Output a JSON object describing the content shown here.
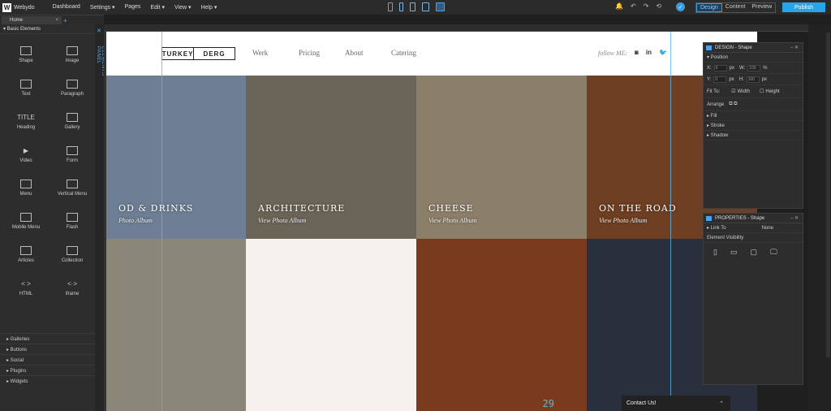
{
  "app": {
    "logo_letter": "W",
    "brand": "Webydo"
  },
  "menu": [
    "Dashboard",
    "Settings ▾",
    "Pages",
    "Edit ▾",
    "View ▾",
    "Help ▾"
  ],
  "modes": {
    "design": "Design",
    "content": "Content",
    "preview": "Preview"
  },
  "publish_label": "Publish",
  "page_tab": {
    "label": "Home",
    "close": "×",
    "add": "+"
  },
  "sidebar": {
    "header": "▾ Basic Elements",
    "elements": [
      {
        "label": "Shape",
        "icon": "shape-icon"
      },
      {
        "label": "Image",
        "icon": "image-icon"
      },
      {
        "label": "Text",
        "icon": "text-icon"
      },
      {
        "label": "Paragraph",
        "icon": "paragraph-icon"
      },
      {
        "label": "Heading",
        "icon": "heading-icon",
        "glyph": "TITLE"
      },
      {
        "label": "Gallery",
        "icon": "gallery-icon"
      },
      {
        "label": "Video",
        "icon": "video-icon",
        "glyph": "▶"
      },
      {
        "label": "Form",
        "icon": "form-icon"
      },
      {
        "label": "Menu",
        "icon": "menu-icon"
      },
      {
        "label": "Vertical Menu",
        "icon": "vertical-menu-icon"
      },
      {
        "label": "Mobile Menu",
        "icon": "mobile-menu-icon"
      },
      {
        "label": "Flash",
        "icon": "flash-icon"
      },
      {
        "label": "Articles",
        "icon": "articles-icon"
      },
      {
        "label": "Collection",
        "icon": "collection-icon"
      },
      {
        "label": "HTML",
        "icon": "html-icon",
        "glyph": "< >"
      },
      {
        "label": "iframe",
        "icon": "iframe-icon",
        "glyph": "<·>"
      }
    ],
    "collapsed": [
      "▸ Galleries",
      "▸ Buttons",
      "▸ Social",
      "▸ Plugins",
      "▸ Widgets"
    ],
    "panel_label": "ELEMENTS PANEL"
  },
  "site": {
    "logo_left": "TURKEY",
    "logo_right": "DERG",
    "nav": [
      "Werk",
      "Pricing",
      "About",
      "Catering"
    ],
    "follow": "follow ME:",
    "social": [
      "◙",
      "in",
      "🐦"
    ]
  },
  "tiles": [
    {
      "title": "OD & DRINKS",
      "sub": "Photo Album",
      "color": "#6e7f95"
    },
    {
      "title": "ARCHITECTURE",
      "sub": "View Photo Album",
      "color": "#6b6558"
    },
    {
      "title": "CHEESE",
      "sub": "View Photo Album",
      "color": "#8c7f6a"
    },
    {
      "title": "ON THE ROAD",
      "sub": "View Photo Album",
      "color": "#6e3f22"
    },
    {
      "title": "",
      "sub": "",
      "color": "#8a8778"
    },
    {
      "title": "",
      "sub": "",
      "color": "#f4f1ee"
    },
    {
      "title": "",
      "sub": "",
      "color": "#7a3a1e"
    },
    {
      "title": "",
      "sub": "",
      "color": "#2a2f3d"
    }
  ],
  "contact": {
    "label": "Contact Us!",
    "caret": "⌃"
  },
  "design_panel": {
    "title": "DESIGN - Shape",
    "sections": [
      "▾ Position",
      "▸ Fill",
      "▸ Stroke",
      "▸ Shadow"
    ],
    "x_label": "X:",
    "x_val": "0",
    "y_label": "Y:",
    "y_val": "0",
    "w_label": "W:",
    "w_val": "100",
    "h_label": "H:",
    "h_val": "100",
    "unit_px": "px",
    "unit_pct": "%",
    "fit_to": "Fit To:",
    "width": "Width",
    "height": "Height",
    "arrange": "Arrange"
  },
  "properties_panel": {
    "title": "PROPERTIES - Shape",
    "link_to": "▸ Link To",
    "link_val": "None",
    "visibility": "Element Visibility"
  },
  "tile_number": "29"
}
